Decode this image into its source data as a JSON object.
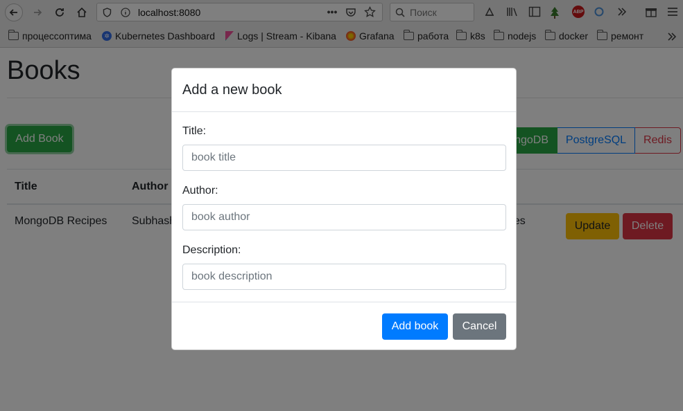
{
  "browser": {
    "url": "localhost:8080",
    "search_placeholder": "Поиск",
    "bookmarks": [
      {
        "label": "процессоптима",
        "icon": "folder-icon"
      },
      {
        "label": "Kubernetes Dashboard",
        "icon": "kubernetes-icon"
      },
      {
        "label": "Logs | Stream - Kibana",
        "icon": "kibana-icon"
      },
      {
        "label": "Grafana",
        "icon": "grafana-icon"
      },
      {
        "label": "работа",
        "icon": "folder-icon"
      },
      {
        "label": "k8s",
        "icon": "folder-icon"
      },
      {
        "label": "nodejs",
        "icon": "folder-icon"
      },
      {
        "label": "docker",
        "icon": "folder-icon"
      },
      {
        "label": "ремонт",
        "icon": "folder-icon"
      }
    ],
    "abp_label": "ABP"
  },
  "page": {
    "title": "Books",
    "add_book_label": "Add Book",
    "db_buttons": {
      "mongo": "MongoDB",
      "postgres": "PostgreSQL",
      "redis": "Redis"
    },
    "table": {
      "headers": {
        "title": "Title",
        "author": "Author"
      },
      "rows": [
        {
          "title": "MongoDB Recipes",
          "author": "Subhashini Chellappan, Dharanitharan Ganesan",
          "description": "Recipes",
          "update_label": "Update",
          "delete_label": "Delete"
        }
      ]
    }
  },
  "modal": {
    "title": "Add a new book",
    "fields": [
      {
        "label": "Title:",
        "placeholder": "book title"
      },
      {
        "label": "Author:",
        "placeholder": "book author"
      },
      {
        "label": "Description:",
        "placeholder": "book description"
      }
    ],
    "submit_label": "Add book",
    "cancel_label": "Cancel"
  },
  "colors": {
    "primary": "#007bff",
    "success": "#28a745",
    "danger": "#dc3545",
    "warning": "#ffc107",
    "secondary": "#6c757d"
  }
}
